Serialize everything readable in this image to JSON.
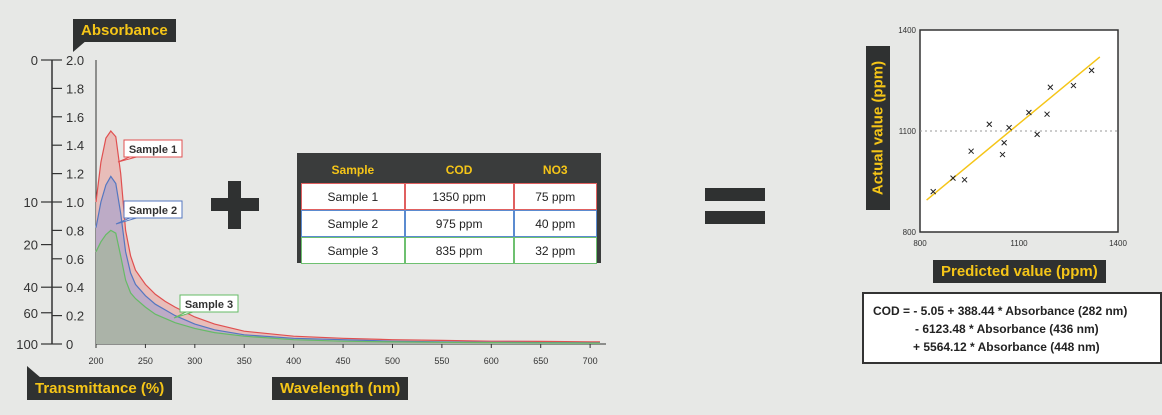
{
  "spectrum": {
    "y_label": "Absorbance",
    "transmittance_label": "Transmittance (%)",
    "x_label": "Wavelength (nm)",
    "absorbance_ticks": [
      "2.0",
      "1.8",
      "1.6",
      "1.4",
      "1.2",
      "1.0",
      "0.8",
      "0.6",
      "0.4",
      "0.2",
      "0"
    ],
    "transmittance_ticks": [
      {
        "label": "0",
        "absorbance": 2.0
      },
      {
        "label": "10",
        "absorbance": 1.0
      },
      {
        "label": "20",
        "absorbance": 0.7
      },
      {
        "label": "40",
        "absorbance": 0.4
      },
      {
        "label": "60",
        "absorbance": 0.22
      },
      {
        "label": "100",
        "absorbance": 0
      }
    ],
    "x_ticks": [
      "200",
      "250",
      "300",
      "350",
      "400",
      "450",
      "500",
      "550",
      "600",
      "650",
      "700"
    ],
    "sample_labels": [
      "Sample 1",
      "Sample 2",
      "Sample 3"
    ],
    "colors": {
      "sample1": "#e05050",
      "sample2": "#5577c0",
      "sample3": "#66bb66"
    }
  },
  "chart_data": {
    "type": "area",
    "title": "",
    "xlabel": "Wavelength (nm)",
    "ylabel": "Absorbance",
    "xlim": [
      200,
      710
    ],
    "ylim": [
      0,
      2.0
    ],
    "series": [
      {
        "name": "Sample 1",
        "x": [
          200,
          205,
          210,
          215,
          220,
          225,
          230,
          235,
          240,
          250,
          260,
          270,
          280,
          300,
          320,
          350,
          400,
          450,
          500,
          550,
          600,
          650,
          700,
          710
        ],
        "y": [
          1.0,
          1.28,
          1.45,
          1.5,
          1.46,
          1.2,
          0.8,
          0.62,
          0.52,
          0.42,
          0.35,
          0.3,
          0.26,
          0.19,
          0.14,
          0.09,
          0.055,
          0.04,
          0.03,
          0.025,
          0.02,
          0.018,
          0.015,
          0.015
        ]
      },
      {
        "name": "Sample 2",
        "x": [
          200,
          205,
          210,
          215,
          220,
          225,
          230,
          235,
          240,
          250,
          260,
          270,
          280,
          300,
          320,
          350,
          400,
          450,
          500,
          550,
          600,
          650,
          700,
          710
        ],
        "y": [
          0.82,
          1.0,
          1.12,
          1.18,
          1.13,
          0.92,
          0.65,
          0.5,
          0.42,
          0.34,
          0.28,
          0.24,
          0.2,
          0.14,
          0.1,
          0.065,
          0.04,
          0.03,
          0.02,
          0.015,
          0.012,
          0.01,
          0.008,
          0.008
        ]
      },
      {
        "name": "Sample 3",
        "x": [
          200,
          205,
          210,
          215,
          220,
          225,
          230,
          235,
          240,
          250,
          260,
          270,
          280,
          300,
          320,
          350,
          400,
          450,
          500,
          550,
          600,
          650,
          700,
          710
        ],
        "y": [
          0.65,
          0.72,
          0.77,
          0.8,
          0.78,
          0.62,
          0.45,
          0.36,
          0.32,
          0.26,
          0.21,
          0.18,
          0.15,
          0.11,
          0.08,
          0.055,
          0.03,
          0.02,
          0.015,
          0.012,
          0.01,
          0.008,
          0.006,
          0.006
        ]
      }
    ]
  },
  "table": {
    "headers": [
      "Sample",
      "COD",
      "NO3"
    ],
    "rows": [
      [
        "Sample 1",
        "1350 ppm",
        "75 ppm"
      ],
      [
        "Sample 2",
        "975 ppm",
        "40 ppm"
      ],
      [
        "Sample 3",
        "835 ppm",
        "32 ppm"
      ]
    ]
  },
  "scatter": {
    "y_label": "Actual value (ppm)",
    "x_label": "Predicted value (ppm)",
    "x_ticks": [
      "800",
      "1100",
      "1400"
    ],
    "y_ticks": [
      "1400",
      "1100",
      "800"
    ],
    "xlim": [
      800,
      1400
    ],
    "ylim": [
      800,
      1400
    ],
    "points": [
      [
        840,
        920
      ],
      [
        900,
        960
      ],
      [
        935,
        955
      ],
      [
        955,
        1040
      ],
      [
        1010,
        1120
      ],
      [
        1050,
        1030
      ],
      [
        1055,
        1065
      ],
      [
        1070,
        1110
      ],
      [
        1130,
        1155
      ],
      [
        1155,
        1090
      ],
      [
        1185,
        1150
      ],
      [
        1195,
        1230
      ],
      [
        1265,
        1235
      ],
      [
        1320,
        1280
      ]
    ],
    "fit": [
      [
        820,
        895
      ],
      [
        1345,
        1320
      ]
    ],
    "line_color": "#f5c518"
  },
  "equation": {
    "line1": "COD = - 5.05 + 388.44 * Absorbance (282 nm)",
    "line2": "- 6123.48 * Absorbance (436 nm)",
    "line3": "+ 5564.12 * Absorbance (448 nm)"
  }
}
